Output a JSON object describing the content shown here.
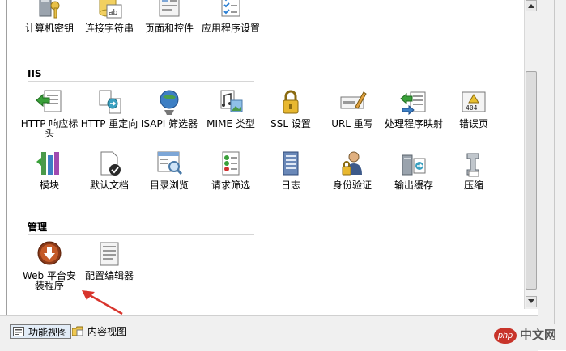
{
  "top_row": [
    {
      "label": "计算机密钥",
      "icon": "machine-key-icon"
    },
    {
      "label": "连接字符串",
      "icon": "connection-strings-icon"
    },
    {
      "label": "页面和控件",
      "icon": "pages-controls-icon"
    },
    {
      "label": "应用程序设置",
      "icon": "app-settings-icon"
    }
  ],
  "iis": {
    "header": "IIS",
    "row1": [
      {
        "label": "HTTP 响应标头",
        "icon": "http-response-headers-icon"
      },
      {
        "label": "HTTP 重定向",
        "icon": "http-redirect-icon"
      },
      {
        "label": "ISAPI 筛选器",
        "icon": "isapi-filters-icon"
      },
      {
        "label": "MIME 类型",
        "icon": "mime-types-icon"
      },
      {
        "label": "SSL 设置",
        "icon": "ssl-lock-icon"
      },
      {
        "label": "URL 重写",
        "icon": "url-rewrite-icon"
      },
      {
        "label": "处理程序映射",
        "icon": "handler-mappings-icon"
      },
      {
        "label": "错误页",
        "icon": "error-pages-icon"
      }
    ],
    "row2": [
      {
        "label": "模块",
        "icon": "modules-icon"
      },
      {
        "label": "默认文档",
        "icon": "default-document-icon"
      },
      {
        "label": "目录浏览",
        "icon": "directory-browsing-icon"
      },
      {
        "label": "请求筛选",
        "icon": "request-filtering-icon"
      },
      {
        "label": "日志",
        "icon": "logging-icon"
      },
      {
        "label": "身份验证",
        "icon": "authentication-icon"
      },
      {
        "label": "输出缓存",
        "icon": "output-caching-icon"
      },
      {
        "label": "压缩",
        "icon": "compression-icon"
      }
    ]
  },
  "manage": {
    "header": "管理",
    "items": [
      {
        "label": "Web 平台安装程序",
        "icon": "web-platform-installer-icon"
      },
      {
        "label": "配置编辑器",
        "icon": "configuration-editor-icon"
      }
    ]
  },
  "bottom_bar": {
    "features_view": "功能视图",
    "content_view": "内容视图"
  },
  "watermark": {
    "logo": "php",
    "text": "中文网"
  },
  "colors": {
    "accent_red": "#d8342c",
    "header_line": "#d6d6d6"
  }
}
